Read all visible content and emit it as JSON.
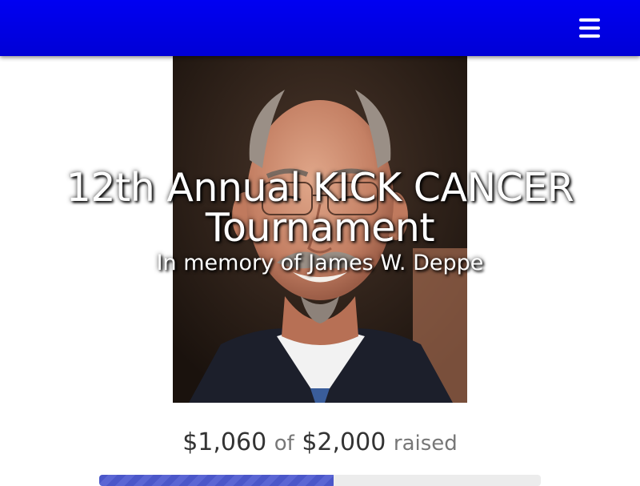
{
  "header": {
    "menu_icon": "hamburger-menu-icon",
    "background_color": "#0000e6"
  },
  "hero": {
    "title": "12th Annual KICK CANCER Tournament",
    "subtitle": "In memory of James W. Deppe"
  },
  "fundraising": {
    "raised_amount": "$1,060",
    "of_label": "of",
    "goal_amount": "$2,000",
    "raised_label": "raised",
    "progress_fraction": 0.53,
    "progress_color": "#4b57c9"
  }
}
